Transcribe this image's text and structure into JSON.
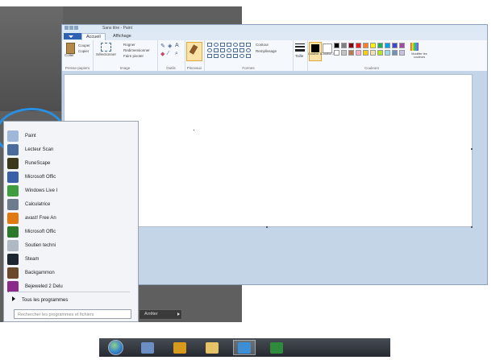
{
  "paint_window": {
    "title": "Sans titre - Paint",
    "file_tab": "",
    "tabs": [
      "Accueil",
      "Affichage"
    ],
    "groups": {
      "clipboard": {
        "label": "Presse-papiers",
        "paste": "Coller",
        "cut": "Couper",
        "copy": "Copier"
      },
      "image": {
        "label": "Image",
        "select": "Sélectionner",
        "crop": "Rogner",
        "resize": "Redimensionner",
        "rotate": "Faire pivoter"
      },
      "tools": {
        "label": "Outils"
      },
      "brushes": {
        "label": "Pinceaux"
      },
      "shapes": {
        "label": "Formes",
        "outline": "Contour",
        "fill": "Remplissage"
      },
      "size": {
        "label": "Taille"
      },
      "colors": {
        "label": "Couleurs",
        "color1": "Couleur 1",
        "color2": "Couleur 2",
        "edit": "Modifier les couleurs"
      }
    },
    "palette": [
      "#000000",
      "#7f7f7f",
      "#880015",
      "#ed1c24",
      "#ff7f27",
      "#fff200",
      "#22b14c",
      "#00a2e8",
      "#3f48cc",
      "#a349a4",
      "#ffffff",
      "#c3c3c3",
      "#b97a57",
      "#ffaec9",
      "#ffc90e",
      "#efe4b0",
      "#b5e61d",
      "#99d9ea",
      "#7092be",
      "#c8bfe7"
    ]
  },
  "start_menu": {
    "items": [
      {
        "label": "Paint",
        "icon": "paint-icon",
        "color": "#9fb7d8"
      },
      {
        "label": "Lecteur Scan",
        "icon": "scanner-icon",
        "color": "#4a6c9c"
      },
      {
        "label": "RuneScape",
        "icon": "runescape-icon",
        "color": "#3a3a1a"
      },
      {
        "label": "Microsoft Offic",
        "icon": "office-icon",
        "color": "#3a5fa8"
      },
      {
        "label": "Windows Live I",
        "icon": "windows-live-icon",
        "color": "#3f9c3f"
      },
      {
        "label": "Calculatrice",
        "icon": "calculator-icon",
        "color": "#6d7b8f"
      },
      {
        "label": "avast! Free An",
        "icon": "avast-icon",
        "color": "#e07a10"
      },
      {
        "label": "Microsoft Offic",
        "icon": "office-icon",
        "color": "#2b7a2b"
      },
      {
        "label": "Soutien techni",
        "icon": "support-icon",
        "color": "#b0b8c4"
      },
      {
        "label": "Steam",
        "icon": "steam-icon",
        "color": "#1c2630"
      },
      {
        "label": "Backgammon",
        "icon": "backgammon-icon",
        "color": "#6b4a2b"
      },
      {
        "label": "Bejeweled 2 Delu",
        "icon": "bejeweled-icon",
        "color": "#8a2a8a"
      }
    ],
    "all_programs": "Tous les programmes",
    "search_placeholder": "Rechercher les programmes et fichiers",
    "shutdown": "Arrêter"
  },
  "taskbar": {
    "items": [
      {
        "icon": "start-orb-icon",
        "color": "#2f7fcf"
      },
      {
        "icon": "paint-icon",
        "color": "#6b8fc4"
      },
      {
        "icon": "eye-app-icon",
        "color": "#d89a1a"
      },
      {
        "icon": "folder-icon",
        "color": "#e6c466"
      },
      {
        "icon": "internet-explorer-icon",
        "color": "#3b8fd6"
      },
      {
        "icon": "excel-icon",
        "color": "#2e8b3c"
      }
    ]
  }
}
